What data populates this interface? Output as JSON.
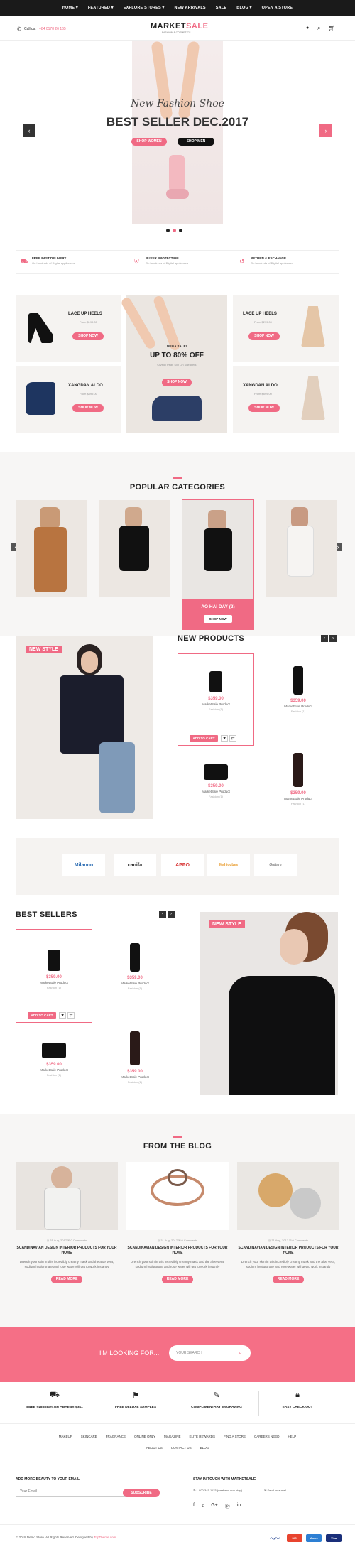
{
  "nav": {
    "items": [
      "HOME ▾",
      "FEATURED ▾",
      "EXPLORE STORES ▾",
      "NEW ARRIVALS",
      "SALE",
      "BLOG ▾",
      "OPEN A STORE"
    ]
  },
  "header": {
    "call_label": "Call us:",
    "phone": "+84 0178 26 165",
    "logo_main": "MARKET",
    "logo_accent": "SALE",
    "logo_tagline": "FASHION & COSMETICS"
  },
  "hero": {
    "script": "New Fashion Shoe",
    "title": "BEST SELLER DEC.2017",
    "btn_women": "SHOP WOMEN",
    "btn_men": "SHOP MEN"
  },
  "services": [
    {
      "title": "FREE FAST DELIVERY",
      "sub": "On hundreds of Digital appliances"
    },
    {
      "title": "BUYER PROTECTION",
      "sub": "On hundreds of Digital appliances"
    },
    {
      "title": "RETURN & EXCHANGE",
      "sub": "On hundreds of Digital appliances"
    }
  ],
  "promo": {
    "left_top": {
      "title": "LACE UP HEELS",
      "sub": "From $199.00",
      "btn": "SHOP NOW"
    },
    "left_bottom": {
      "title": "XANGDAN ALDO",
      "sub": "From $899.00",
      "btn": "SHOP NOW"
    },
    "center": {
      "label": "MEGA SALE!",
      "title": "UP TO 80% OFF",
      "sub": "Crystal Pearl Slip On Sneakers",
      "btn": "SHOP NOW"
    },
    "right_top": {
      "title": "LACE UP HEELS",
      "sub": "From $299.00",
      "btn": "SHOP NOW"
    },
    "right_bottom": {
      "title": "XANGDAN ALDO",
      "sub": "From $899.00",
      "btn": "SHOP NOW"
    }
  },
  "categories": {
    "heading": "POPULAR CATEGORIES",
    "active_label": "AO HAI DAY",
    "active_count": "(2)",
    "active_btn": "SHOP NOW"
  },
  "new_products": {
    "heading": "NEW PRODUCTS",
    "badge": "NEW STYLE",
    "add_to_cart": "ADD TO CART",
    "items": [
      {
        "price": "$359.00",
        "name": "MarketSale Product",
        "cat": "Fashion (1)"
      },
      {
        "price": "$359.00",
        "name": "MarketSale Product",
        "cat": "Fashion (1)"
      },
      {
        "price": "$359.00",
        "name": "MarketSale Product",
        "cat": "Fashion (1)"
      },
      {
        "price": "$359.00",
        "name": "MarketSale Product",
        "cat": "Fashion (1)"
      }
    ]
  },
  "brands": [
    "Milanno",
    "canifa",
    "APPO",
    "Mahjoubes",
    "Guitare"
  ],
  "best_sellers": {
    "heading": "BEST SELLERS",
    "badge": "NEW STYLE",
    "add_to_cart": "ADD TO CART",
    "items": [
      {
        "price": "$359.00",
        "name": "MarketSale Product",
        "cat": "Fashion (1)"
      },
      {
        "price": "$359.00",
        "name": "MarketSale Product",
        "cat": "Fashion (1)"
      },
      {
        "price": "$359.00",
        "name": "MarketSale Product",
        "cat": "Fashion (1)"
      },
      {
        "price": "$359.00",
        "name": "MarketSale Product",
        "cat": "Fashion (1)"
      }
    ]
  },
  "blog": {
    "heading": "FROM THE BLOG",
    "posts": [
      {
        "date": "31 Aug, 2017",
        "comments": "0 Comments",
        "title": "SCANDINAVIAN DESIGN INTERIOR PRODUCTS FOR YOUR HOME",
        "text": "Drench your skin in this incredibly creamy mask and the aloe vera, sodium hyaluronate and rose water will get to work instantly",
        "btn": "READ MORE"
      },
      {
        "date": "31 Aug, 2017",
        "comments": "0 Comments",
        "title": "SCANDINAVIAN DESIGN INTERIOR PRODUCTS FOR YOUR HOME",
        "text": "Drench your skin in this incredibly creamy mask and the aloe vera, sodium hyaluronate and rose water will get to work instantly",
        "btn": "READ MORE"
      },
      {
        "date": "31 Aug, 2017",
        "comments": "0 Comments",
        "title": "SCANDINAVIAN DESIGN INTERIOR PRODUCTS FOR YOUR HOME",
        "text": "Drench your skin in this incredibly creamy mask and the aloe vera, sodium hyaluronate and rose water will get to work instantly",
        "btn": "READ MORE"
      }
    ]
  },
  "search": {
    "label": "I'M LOOKING FOR...",
    "placeholder": "YOUR SEARCH"
  },
  "features": [
    "FREE SHIPPING ON ORDERS $49+",
    "FREE DELUXE SAMPLES",
    "COMPLIMENTARY ENGRAVING",
    "EASY CHECK OUT"
  ],
  "footer_links_1": [
    "MAKEUP",
    "SKINCARE",
    "FRAGRANCE",
    "ONLINE ONLY",
    "MAGAZINE",
    "ELITE REWARDS",
    "FIND A STORE",
    "CAREERS NEED",
    "HELP"
  ],
  "footer_links_2": [
    "ABOUT US",
    "CONTACT US",
    "BLOG"
  ],
  "newsletter": {
    "heading": "ADD MORE BEAUTY TO YOUR EMAIL",
    "placeholder": "Your Email",
    "btn": "SUBSCRIBE"
  },
  "contact": {
    "heading": "STAY IN TOUCH WITH MARKETSALE",
    "phone": "1-800-345-1123 (weekend non-stop)",
    "email": "Send us a mail"
  },
  "copyright": {
    "text": "© 2018 Demo Store. All Rights Reserved. Designed by",
    "link": "TopTheme.com"
  },
  "payments": [
    "PayPal",
    "MC",
    "Amex",
    "Visa"
  ]
}
